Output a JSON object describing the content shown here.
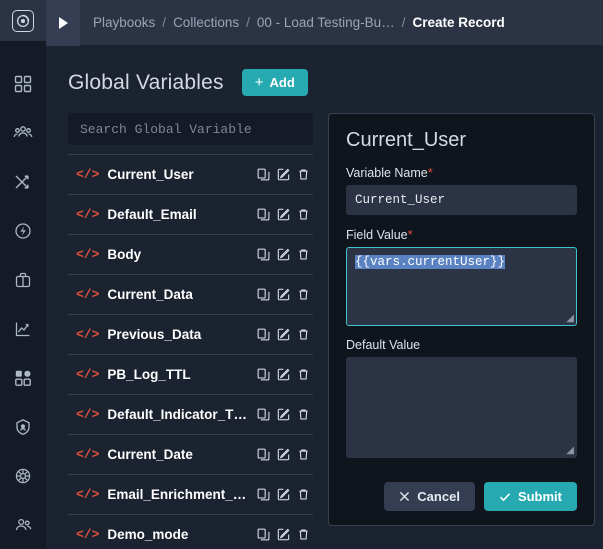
{
  "topbar": {
    "logo_icon": "target-logo-icon",
    "toggle_icon": "play-triangle-icon",
    "breadcrumb": [
      {
        "label": "Playbooks",
        "current": false
      },
      {
        "label": "Collections",
        "current": false
      },
      {
        "label": "00 - Load Testing-Bu…",
        "current": false
      },
      {
        "label": "Create Record",
        "current": true
      }
    ],
    "separator": "/"
  },
  "sidebar": {
    "items": [
      {
        "icon": "dashboard-grid-icon"
      },
      {
        "icon": "people-group-icon"
      },
      {
        "icon": "shuffle-arrows-icon"
      },
      {
        "icon": "lightning-circle-icon"
      },
      {
        "icon": "briefcase-icon"
      },
      {
        "icon": "chart-line-icon"
      },
      {
        "icon": "apps-grid-icon"
      },
      {
        "icon": "shield-badge-icon"
      },
      {
        "icon": "globe-web-icon"
      },
      {
        "icon": "user-group-icon"
      }
    ]
  },
  "page": {
    "title": "Global Variables",
    "add_label": "Add",
    "add_plus": "+"
  },
  "list": {
    "search_placeholder": "Search Global Variable",
    "search_value": "",
    "row_icon": "code-tag-icon",
    "actions": [
      "copy-icon",
      "edit-icon",
      "delete-icon"
    ],
    "items": [
      {
        "name": "Current_User"
      },
      {
        "name": "Default_Email"
      },
      {
        "name": "Body"
      },
      {
        "name": "Current_Data"
      },
      {
        "name": "Previous_Data"
      },
      {
        "name": "PB_Log_TTL"
      },
      {
        "name": "Default_Indicator_TTL…"
      },
      {
        "name": "Current_Date"
      },
      {
        "name": "Email_Enrichment_Pla…"
      },
      {
        "name": "Demo_mode"
      }
    ]
  },
  "detail": {
    "title": "Current_User",
    "variable_name_label": "Variable Name",
    "variable_name_value": "Current_User",
    "field_value_label": "Field Value",
    "field_value_text": "{{vars.currentUser}}",
    "default_value_label": "Default Value",
    "default_value_text": "",
    "required_mark": "*",
    "cancel_label": "Cancel",
    "submit_label": "Submit",
    "cancel_icon": "close-x-icon",
    "submit_icon": "check-icon"
  },
  "colors": {
    "accent_teal": "#26a9b0",
    "code_red": "#e0523d",
    "selection_blue": "#5b82c0",
    "focus_cyan": "#3ec4cc",
    "page_bg": "#1b2230",
    "rail_bg": "#141a26",
    "panel_bg": "#0f141d"
  }
}
